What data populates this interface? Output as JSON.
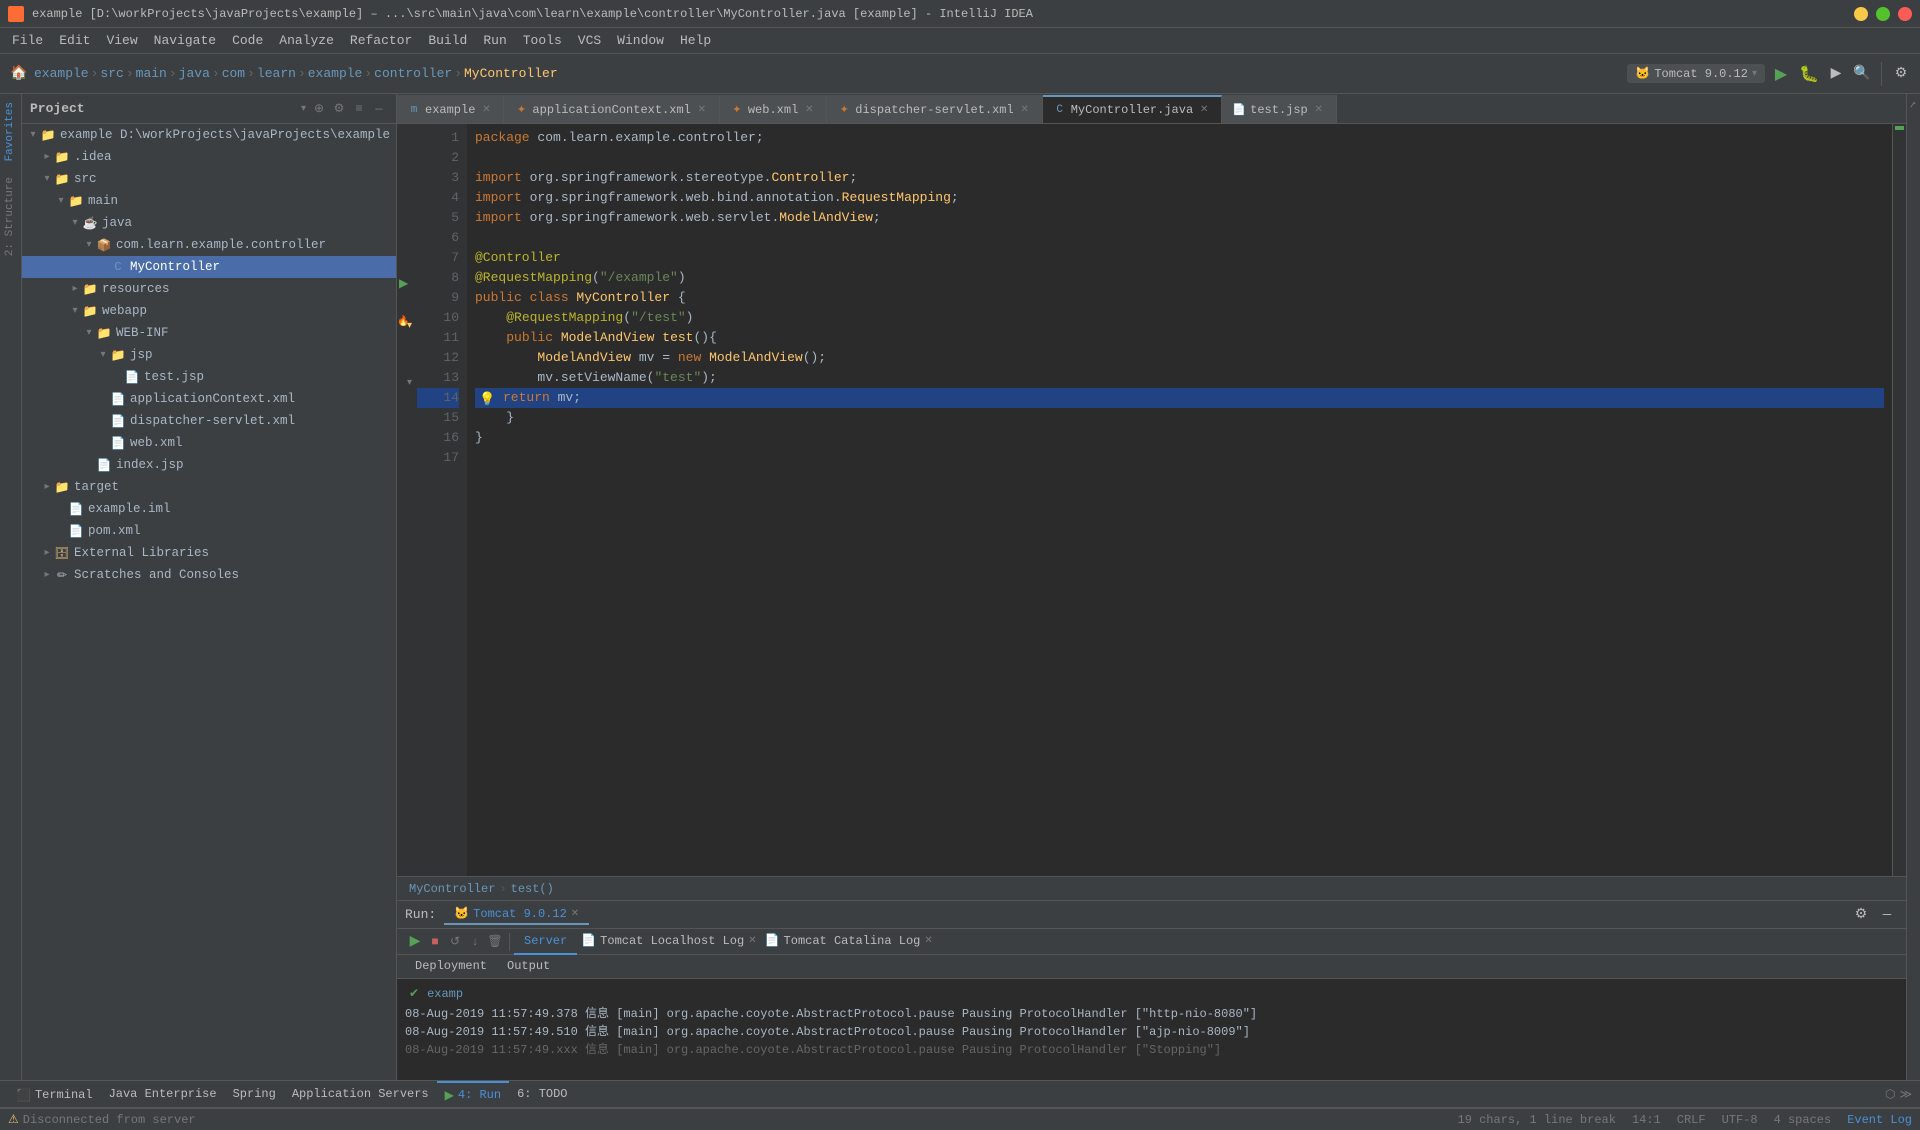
{
  "window": {
    "title": "example [D:\\workProjects\\javaProjects\\example] – ...\\src\\main\\java\\com\\learn\\example\\controller\\MyController.java [example] - IntelliJ IDEA"
  },
  "menu": {
    "items": [
      "File",
      "Edit",
      "View",
      "Navigate",
      "Code",
      "Analyze",
      "Refactor",
      "Build",
      "Run",
      "Tools",
      "VCS",
      "Window",
      "Help"
    ]
  },
  "toolbar": {
    "breadcrumbs": [
      {
        "label": "example",
        "type": "project"
      },
      {
        "label": "src",
        "type": "folder"
      },
      {
        "label": "main",
        "type": "folder"
      },
      {
        "label": "java",
        "type": "folder"
      },
      {
        "label": "com",
        "type": "folder"
      },
      {
        "label": "learn",
        "type": "folder"
      },
      {
        "label": "example",
        "type": "folder"
      },
      {
        "label": "controller",
        "type": "folder"
      },
      {
        "label": "MyController",
        "type": "class"
      }
    ],
    "run_config": "Tomcat 9.0.12"
  },
  "project_panel": {
    "title": "Project",
    "tree": [
      {
        "level": 0,
        "label": "example D:\\workProjects\\javaProjects\\example",
        "type": "project",
        "expanded": true
      },
      {
        "level": 1,
        "label": ".idea",
        "type": "folder",
        "expanded": false
      },
      {
        "level": 1,
        "label": "src",
        "type": "folder",
        "expanded": true
      },
      {
        "level": 2,
        "label": "main",
        "type": "folder",
        "expanded": true
      },
      {
        "level": 3,
        "label": "java",
        "type": "folder",
        "expanded": true
      },
      {
        "level": 4,
        "label": "com.learn.example.controller",
        "type": "package",
        "expanded": true
      },
      {
        "level": 5,
        "label": "MyController",
        "type": "java",
        "selected": true
      },
      {
        "level": 3,
        "label": "resources",
        "type": "folder",
        "expanded": false
      },
      {
        "level": 3,
        "label": "webapp",
        "type": "folder",
        "expanded": true
      },
      {
        "level": 4,
        "label": "WEB-INF",
        "type": "folder",
        "expanded": true
      },
      {
        "level": 5,
        "label": "jsp",
        "type": "folder",
        "expanded": true
      },
      {
        "level": 6,
        "label": "test.jsp",
        "type": "jsp"
      },
      {
        "level": 5,
        "label": "applicationContext.xml",
        "type": "xml"
      },
      {
        "level": 5,
        "label": "dispatcher-servlet.xml",
        "type": "xml"
      },
      {
        "level": 5,
        "label": "web.xml",
        "type": "xml"
      },
      {
        "level": 4,
        "label": "index.jsp",
        "type": "jsp"
      },
      {
        "level": 1,
        "label": "target",
        "type": "folder",
        "expanded": false
      },
      {
        "level": 2,
        "label": "example.iml",
        "type": "iml"
      },
      {
        "level": 2,
        "label": "pom.xml",
        "type": "xml"
      },
      {
        "level": 1,
        "label": "External Libraries",
        "type": "lib",
        "expanded": false
      },
      {
        "level": 1,
        "label": "Scratches and Consoles",
        "type": "scratch"
      }
    ]
  },
  "tabs": [
    {
      "label": "example",
      "type": "java",
      "active": false
    },
    {
      "label": "applicationContext.xml",
      "type": "xml",
      "active": false
    },
    {
      "label": "web.xml",
      "type": "xml",
      "active": false
    },
    {
      "label": "dispatcher-servlet.xml",
      "type": "xml",
      "active": false
    },
    {
      "label": "MyController.java",
      "type": "java",
      "active": true
    },
    {
      "label": "test.jsp",
      "type": "jsp",
      "active": false
    }
  ],
  "code": {
    "lines": [
      {
        "num": 1,
        "content": "package com.learn.example.controller;",
        "tokens": [
          {
            "text": "package ",
            "cls": "kw"
          },
          {
            "text": "com.learn.example.controller",
            "cls": ""
          },
          {
            "text": ";",
            "cls": ""
          }
        ]
      },
      {
        "num": 2,
        "content": "",
        "tokens": []
      },
      {
        "num": 3,
        "content": "import org.springframework.stereotype.Controller;",
        "tokens": [
          {
            "text": "import ",
            "cls": "kw"
          },
          {
            "text": "org.springframework.stereotype.",
            "cls": ""
          },
          {
            "text": "Controller",
            "cls": "class-name"
          },
          {
            "text": ";",
            "cls": ""
          }
        ]
      },
      {
        "num": 4,
        "content": "import org.springframework.web.bind.annotation.RequestMapping;",
        "tokens": [
          {
            "text": "import ",
            "cls": "kw"
          },
          {
            "text": "org.springframework.web.bind.annotation.",
            "cls": ""
          },
          {
            "text": "RequestMapping",
            "cls": "class-name"
          },
          {
            "text": ";",
            "cls": ""
          }
        ]
      },
      {
        "num": 5,
        "content": "import org.springframework.web.servlet.ModelAndView;",
        "tokens": [
          {
            "text": "import ",
            "cls": "kw"
          },
          {
            "text": "org.springframework.web.servlet.",
            "cls": ""
          },
          {
            "text": "ModelAndView",
            "cls": "class-name"
          },
          {
            "text": ";",
            "cls": ""
          }
        ]
      },
      {
        "num": 6,
        "content": "",
        "tokens": []
      },
      {
        "num": 7,
        "content": "@Controller",
        "tokens": [
          {
            "text": "@Controller",
            "cls": "annotation"
          }
        ]
      },
      {
        "num": 8,
        "content": "@RequestMapping(\"/example\")",
        "tokens": [
          {
            "text": "@RequestMapping",
            "cls": "annotation"
          },
          {
            "text": "(",
            "cls": ""
          },
          {
            "text": "\"/example\"",
            "cls": "string"
          },
          {
            "text": ")",
            "cls": ""
          }
        ]
      },
      {
        "num": 9,
        "content": "public class MyController {",
        "tokens": [
          {
            "text": "public ",
            "cls": "kw"
          },
          {
            "text": "class ",
            "cls": "kw"
          },
          {
            "text": "MyController",
            "cls": "class-name"
          },
          {
            "text": " {",
            "cls": ""
          }
        ]
      },
      {
        "num": 10,
        "content": "    @RequestMapping(\"/test\")",
        "tokens": [
          {
            "text": "    ",
            "cls": ""
          },
          {
            "text": "@RequestMapping",
            "cls": "annotation"
          },
          {
            "text": "(",
            "cls": ""
          },
          {
            "text": "\"/test\"",
            "cls": "string"
          },
          {
            "text": ")",
            "cls": ""
          }
        ]
      },
      {
        "num": 11,
        "content": "    public ModelAndView test(){",
        "tokens": [
          {
            "text": "    ",
            "cls": ""
          },
          {
            "text": "public ",
            "cls": "kw"
          },
          {
            "text": "ModelAndView",
            "cls": "class-name"
          },
          {
            "text": " ",
            "cls": ""
          },
          {
            "text": "test",
            "cls": "method"
          },
          {
            "text": "(){",
            "cls": ""
          }
        ]
      },
      {
        "num": 12,
        "content": "        ModelAndView mv = new ModelAndView();",
        "tokens": [
          {
            "text": "        ",
            "cls": ""
          },
          {
            "text": "ModelAndView",
            "cls": "class-name"
          },
          {
            "text": " mv = ",
            "cls": ""
          },
          {
            "text": "new ",
            "cls": "kw"
          },
          {
            "text": "ModelAndView",
            "cls": "class-name"
          },
          {
            "text": "();",
            "cls": ""
          }
        ]
      },
      {
        "num": 13,
        "content": "        mv.setViewName(\"test\");",
        "tokens": [
          {
            "text": "        mv.setViewName(",
            "cls": ""
          },
          {
            "text": "\"test\"",
            "cls": "string"
          },
          {
            "text": ");",
            "cls": ""
          }
        ]
      },
      {
        "num": 14,
        "content": "        return mv;",
        "highlighted": true,
        "tokens": [
          {
            "text": "        ",
            "cls": ""
          },
          {
            "text": "return ",
            "cls": "kw"
          },
          {
            "text": "mv",
            "cls": ""
          },
          {
            "text": ";",
            "cls": ""
          }
        ]
      },
      {
        "num": 15,
        "content": "    }",
        "tokens": [
          {
            "text": "    }",
            "cls": ""
          }
        ]
      },
      {
        "num": 16,
        "content": "}",
        "tokens": [
          {
            "text": "}",
            "cls": ""
          }
        ]
      },
      {
        "num": 17,
        "content": "",
        "tokens": []
      }
    ]
  },
  "status_breadcrumb": {
    "items": [
      "MyController",
      "test()"
    ]
  },
  "bottom_panel": {
    "run_label": "Run:",
    "tomcat_tab": "Tomcat 9.0.12",
    "server_tab": "Server",
    "localhost_tab": "Tomcat Localhost Log",
    "catalina_tab": "Tomcat Catalina Log",
    "sub_tabs": [
      "Deployment",
      "Output"
    ],
    "deploy_items": [
      {
        "name": "examp",
        "status": "green"
      }
    ],
    "log_lines": [
      "08-Aug-2019 11:57:49.378 信息 [main] org.apache.coyote.AbstractProtocol.pause Pausing ProtocolHandler [\"http-nio-8080\"]",
      "08-Aug-2019 11:57:49.510 信息 [main] org.apache.coyote.AbstractProtocol.pause Pausing ProtocolHandler [\"ajp-nio-8009\"]",
      "08-Aug-2019 11:57:49.xxx 信息 [main] org.apache.coyote.AbstractProtocol.pause Pausing ProtocolHandler [\"Stopping\"]"
    ]
  },
  "status_bar": {
    "message": "Disconnected from server",
    "chars": "19 chars, 1 line break",
    "position": "14:1",
    "line_ending": "CRLF",
    "encoding": "UTF-8",
    "indent": "4 spaces",
    "event_log": "Event Log"
  },
  "bottom_tabs": [
    {
      "label": "Terminal",
      "active": false
    },
    {
      "label": "Java Enterprise",
      "active": false
    },
    {
      "label": "Spring",
      "active": false
    },
    {
      "label": "Application Servers",
      "active": false
    },
    {
      "label": "4: Run",
      "active": true
    },
    {
      "label": "6: TODO",
      "active": false
    }
  ]
}
